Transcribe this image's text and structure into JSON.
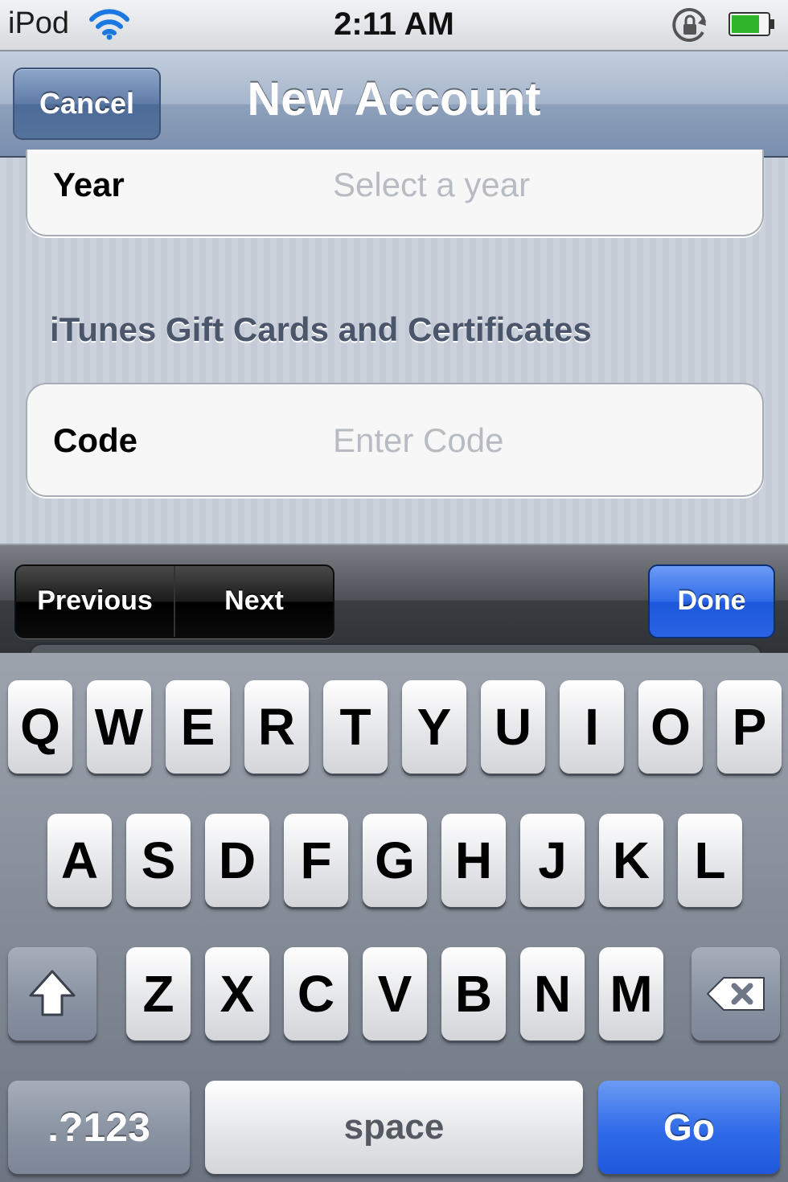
{
  "status_bar": {
    "carrier": "iPod",
    "time": "2:11 AM",
    "icons": [
      "wifi-icon",
      "rotation-lock-icon",
      "battery-icon"
    ]
  },
  "nav_bar": {
    "cancel_label": "Cancel",
    "title": "New Account"
  },
  "form": {
    "year": {
      "label": "Year",
      "placeholder": "Select a year"
    },
    "gift_section_header": "iTunes Gift Cards and Certificates",
    "code": {
      "label": "Code",
      "placeholder": "Enter Code"
    }
  },
  "accessory_bar": {
    "previous_label": "Previous",
    "next_label": "Next",
    "done_label": "Done"
  },
  "keyboard": {
    "row1": [
      "Q",
      "W",
      "E",
      "R",
      "T",
      "Y",
      "U",
      "I",
      "O",
      "P"
    ],
    "row2": [
      "A",
      "S",
      "D",
      "F",
      "G",
      "H",
      "J",
      "K",
      "L"
    ],
    "row3": [
      "Z",
      "X",
      "C",
      "V",
      "B",
      "N",
      "M"
    ],
    "numbers_label": ".?123",
    "space_label": "space",
    "go_label": "Go",
    "shift_icon": "shift-arrow-icon",
    "delete_icon": "backspace-icon"
  },
  "colors": {
    "nav_blue": "#7a8fae",
    "accent_blue": "#2f6ae8",
    "placeholder_gray": "#b8bcc2"
  }
}
